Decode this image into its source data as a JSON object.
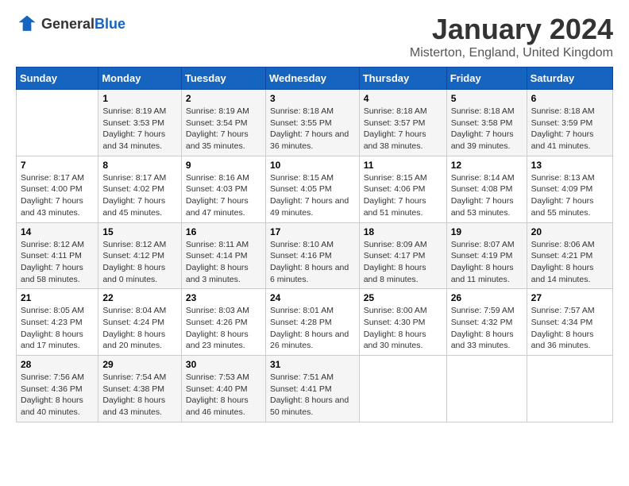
{
  "header": {
    "logo_general": "General",
    "logo_blue": "Blue",
    "title": "January 2024",
    "subtitle": "Misterton, England, United Kingdom"
  },
  "calendar": {
    "days_of_week": [
      "Sunday",
      "Monday",
      "Tuesday",
      "Wednesday",
      "Thursday",
      "Friday",
      "Saturday"
    ],
    "weeks": [
      [
        {
          "day": "",
          "sunrise": "",
          "sunset": "",
          "daylight": "",
          "empty": true
        },
        {
          "day": "1",
          "sunrise": "Sunrise: 8:19 AM",
          "sunset": "Sunset: 3:53 PM",
          "daylight": "Daylight: 7 hours and 34 minutes."
        },
        {
          "day": "2",
          "sunrise": "Sunrise: 8:19 AM",
          "sunset": "Sunset: 3:54 PM",
          "daylight": "Daylight: 7 hours and 35 minutes."
        },
        {
          "day": "3",
          "sunrise": "Sunrise: 8:18 AM",
          "sunset": "Sunset: 3:55 PM",
          "daylight": "Daylight: 7 hours and 36 minutes."
        },
        {
          "day": "4",
          "sunrise": "Sunrise: 8:18 AM",
          "sunset": "Sunset: 3:57 PM",
          "daylight": "Daylight: 7 hours and 38 minutes."
        },
        {
          "day": "5",
          "sunrise": "Sunrise: 8:18 AM",
          "sunset": "Sunset: 3:58 PM",
          "daylight": "Daylight: 7 hours and 39 minutes."
        },
        {
          "day": "6",
          "sunrise": "Sunrise: 8:18 AM",
          "sunset": "Sunset: 3:59 PM",
          "daylight": "Daylight: 7 hours and 41 minutes."
        }
      ],
      [
        {
          "day": "7",
          "sunrise": "Sunrise: 8:17 AM",
          "sunset": "Sunset: 4:00 PM",
          "daylight": "Daylight: 7 hours and 43 minutes."
        },
        {
          "day": "8",
          "sunrise": "Sunrise: 8:17 AM",
          "sunset": "Sunset: 4:02 PM",
          "daylight": "Daylight: 7 hours and 45 minutes."
        },
        {
          "day": "9",
          "sunrise": "Sunrise: 8:16 AM",
          "sunset": "Sunset: 4:03 PM",
          "daylight": "Daylight: 7 hours and 47 minutes."
        },
        {
          "day": "10",
          "sunrise": "Sunrise: 8:15 AM",
          "sunset": "Sunset: 4:05 PM",
          "daylight": "Daylight: 7 hours and 49 minutes."
        },
        {
          "day": "11",
          "sunrise": "Sunrise: 8:15 AM",
          "sunset": "Sunset: 4:06 PM",
          "daylight": "Daylight: 7 hours and 51 minutes."
        },
        {
          "day": "12",
          "sunrise": "Sunrise: 8:14 AM",
          "sunset": "Sunset: 4:08 PM",
          "daylight": "Daylight: 7 hours and 53 minutes."
        },
        {
          "day": "13",
          "sunrise": "Sunrise: 8:13 AM",
          "sunset": "Sunset: 4:09 PM",
          "daylight": "Daylight: 7 hours and 55 minutes."
        }
      ],
      [
        {
          "day": "14",
          "sunrise": "Sunrise: 8:12 AM",
          "sunset": "Sunset: 4:11 PM",
          "daylight": "Daylight: 7 hours and 58 minutes."
        },
        {
          "day": "15",
          "sunrise": "Sunrise: 8:12 AM",
          "sunset": "Sunset: 4:12 PM",
          "daylight": "Daylight: 8 hours and 0 minutes."
        },
        {
          "day": "16",
          "sunrise": "Sunrise: 8:11 AM",
          "sunset": "Sunset: 4:14 PM",
          "daylight": "Daylight: 8 hours and 3 minutes."
        },
        {
          "day": "17",
          "sunrise": "Sunrise: 8:10 AM",
          "sunset": "Sunset: 4:16 PM",
          "daylight": "Daylight: 8 hours and 6 minutes."
        },
        {
          "day": "18",
          "sunrise": "Sunrise: 8:09 AM",
          "sunset": "Sunset: 4:17 PM",
          "daylight": "Daylight: 8 hours and 8 minutes."
        },
        {
          "day": "19",
          "sunrise": "Sunrise: 8:07 AM",
          "sunset": "Sunset: 4:19 PM",
          "daylight": "Daylight: 8 hours and 11 minutes."
        },
        {
          "day": "20",
          "sunrise": "Sunrise: 8:06 AM",
          "sunset": "Sunset: 4:21 PM",
          "daylight": "Daylight: 8 hours and 14 minutes."
        }
      ],
      [
        {
          "day": "21",
          "sunrise": "Sunrise: 8:05 AM",
          "sunset": "Sunset: 4:23 PM",
          "daylight": "Daylight: 8 hours and 17 minutes."
        },
        {
          "day": "22",
          "sunrise": "Sunrise: 8:04 AM",
          "sunset": "Sunset: 4:24 PM",
          "daylight": "Daylight: 8 hours and 20 minutes."
        },
        {
          "day": "23",
          "sunrise": "Sunrise: 8:03 AM",
          "sunset": "Sunset: 4:26 PM",
          "daylight": "Daylight: 8 hours and 23 minutes."
        },
        {
          "day": "24",
          "sunrise": "Sunrise: 8:01 AM",
          "sunset": "Sunset: 4:28 PM",
          "daylight": "Daylight: 8 hours and 26 minutes."
        },
        {
          "day": "25",
          "sunrise": "Sunrise: 8:00 AM",
          "sunset": "Sunset: 4:30 PM",
          "daylight": "Daylight: 8 hours and 30 minutes."
        },
        {
          "day": "26",
          "sunrise": "Sunrise: 7:59 AM",
          "sunset": "Sunset: 4:32 PM",
          "daylight": "Daylight: 8 hours and 33 minutes."
        },
        {
          "day": "27",
          "sunrise": "Sunrise: 7:57 AM",
          "sunset": "Sunset: 4:34 PM",
          "daylight": "Daylight: 8 hours and 36 minutes."
        }
      ],
      [
        {
          "day": "28",
          "sunrise": "Sunrise: 7:56 AM",
          "sunset": "Sunset: 4:36 PM",
          "daylight": "Daylight: 8 hours and 40 minutes."
        },
        {
          "day": "29",
          "sunrise": "Sunrise: 7:54 AM",
          "sunset": "Sunset: 4:38 PM",
          "daylight": "Daylight: 8 hours and 43 minutes."
        },
        {
          "day": "30",
          "sunrise": "Sunrise: 7:53 AM",
          "sunset": "Sunset: 4:40 PM",
          "daylight": "Daylight: 8 hours and 46 minutes."
        },
        {
          "day": "31",
          "sunrise": "Sunrise: 7:51 AM",
          "sunset": "Sunset: 4:41 PM",
          "daylight": "Daylight: 8 hours and 50 minutes."
        },
        {
          "day": "",
          "sunrise": "",
          "sunset": "",
          "daylight": "",
          "empty": true
        },
        {
          "day": "",
          "sunrise": "",
          "sunset": "",
          "daylight": "",
          "empty": true
        },
        {
          "day": "",
          "sunrise": "",
          "sunset": "",
          "daylight": "",
          "empty": true
        }
      ]
    ]
  }
}
